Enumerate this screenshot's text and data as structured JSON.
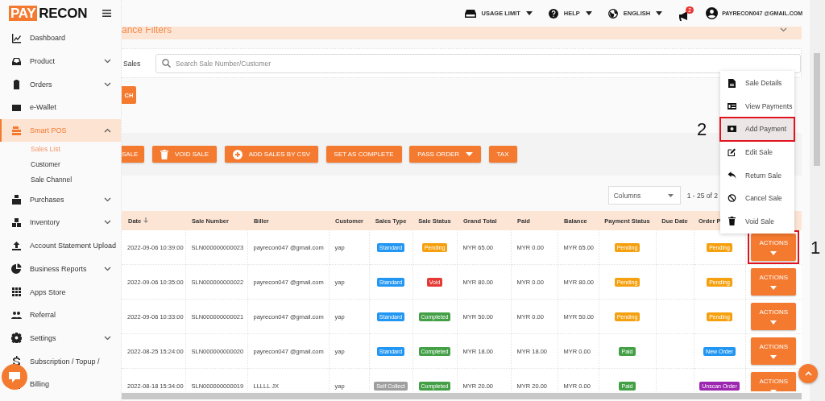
{
  "logo": {
    "left": "PAY",
    "right": "RECON"
  },
  "topbar": {
    "items": [
      {
        "label": "USAGE LIMIT",
        "kind": "storage"
      },
      {
        "label": "HELP",
        "kind": "help"
      },
      {
        "label": "ENGLISH",
        "kind": "globe"
      }
    ],
    "notifications": "2",
    "user": "PAYRECON047 @GMAIL.COM"
  },
  "sidebar": {
    "items": [
      {
        "label": "Dashboard",
        "selected": false
      },
      {
        "label": "Product",
        "selected": false,
        "expanded": false
      },
      {
        "label": "Orders",
        "selected": false,
        "expanded": false
      },
      {
        "label": "e-Wallet",
        "selected": false
      },
      {
        "label": "Smart POS",
        "selected": true,
        "expanded": true,
        "children": [
          {
            "label": "Sales List",
            "selected": true
          },
          {
            "label": "Customer",
            "selected": false
          },
          {
            "label": "Sale Channel",
            "selected": false
          }
        ]
      },
      {
        "label": "Purchases",
        "selected": false,
        "expanded": false
      },
      {
        "label": "Inventory",
        "selected": false,
        "expanded": false
      },
      {
        "label": "Account Statement Upload",
        "selected": false
      },
      {
        "label": "Business Reports",
        "selected": false,
        "expanded": false
      },
      {
        "label": "Apps Store",
        "selected": false
      },
      {
        "label": "Referral",
        "selected": false
      },
      {
        "label": "Settings",
        "selected": false,
        "expanded": false
      },
      {
        "label": "Subscription / Topup /",
        "selected": false
      },
      {
        "label": "Billing",
        "selected": false
      }
    ]
  },
  "filters": {
    "title": "ance Filters"
  },
  "search": {
    "label": "Sales",
    "placeholder": "Search Sale Number/Customer",
    "button": "CH"
  },
  "toolbar": [
    {
      "label": "SALE",
      "kind": "plain"
    },
    {
      "label": "VOID SALE",
      "kind": "trash"
    },
    {
      "label": "ADD SALES BY CSV",
      "kind": "add"
    },
    {
      "label": "SET AS COMPLETE",
      "kind": "plain"
    },
    {
      "label": "PASS ORDER",
      "kind": "dropdown"
    },
    {
      "label": "TAX",
      "kind": "plain"
    }
  ],
  "columns_select": {
    "placeholder": "Columns"
  },
  "pagination": "1 - 25 of 2",
  "table": {
    "columns": [
      "Date",
      "Sale Number",
      "Biller",
      "Customer",
      "Sales Type",
      "Sale Status",
      "Grand Total",
      "Paid",
      "Balance",
      "Payment Status",
      "Due Date",
      "Order P"
    ],
    "rows": [
      {
        "date": "2022-09-06 10:39:00",
        "sale_number": "SLN000000000023",
        "biller": "payrecon047 @gmail.com",
        "customer": "yap",
        "sales_type": {
          "text": "Standard",
          "color": "#2196f3"
        },
        "sale_status": {
          "text": "Pending",
          "color": "#f5a00f"
        },
        "grand_total": "MYR 65.00",
        "paid": "MYR 0.00",
        "balance": "MYR 65.00",
        "payment_status": {
          "text": "Pending",
          "color": "#f5a00f"
        },
        "order_status": {
          "text": "Pending",
          "color": "#f5a00f"
        },
        "action": "ACTIONS",
        "highlighted": true
      },
      {
        "date": "2022-09-06 10:35:00",
        "sale_number": "SLN000000000022",
        "biller": "payrecon047 @gmail.com",
        "customer": "yap",
        "sales_type": {
          "text": "Standard",
          "color": "#2196f3"
        },
        "sale_status": {
          "text": "Void",
          "color": "#e53935"
        },
        "grand_total": "MYR 80.00",
        "paid": "MYR 0.00",
        "balance": "MYR 80.00",
        "payment_status": {
          "text": "Pending",
          "color": "#f5a00f"
        },
        "order_status": {
          "text": "Pending",
          "color": "#f5a00f"
        },
        "action": "ACTIONS",
        "highlighted": false
      },
      {
        "date": "2022-09-06 10:33:00",
        "sale_number": "SLN000000000021",
        "biller": "payrecon047 @gmail.com",
        "customer": "yap",
        "sales_type": {
          "text": "Standard",
          "color": "#2196f3"
        },
        "sale_status": {
          "text": "Completed",
          "color": "#43a047"
        },
        "grand_total": "MYR 50.00",
        "paid": "MYR 0.00",
        "balance": "MYR 50.00",
        "payment_status": {
          "text": "Pending",
          "color": "#f5a00f"
        },
        "order_status": {
          "text": "Pending",
          "color": "#f5a00f"
        },
        "action": "ACTIONS",
        "highlighted": false
      },
      {
        "date": "2022-08-25 15:24:00",
        "sale_number": "SLN000000000020",
        "biller": "payrecon047 @gmail.com",
        "customer": "yap",
        "sales_type": {
          "text": "Standard",
          "color": "#2196f3"
        },
        "sale_status": {
          "text": "Completed",
          "color": "#43a047"
        },
        "grand_total": "MYR 18.00",
        "paid": "MYR 18.00",
        "balance": "MYR 0.00",
        "payment_status": {
          "text": "Paid",
          "color": "#43a047"
        },
        "order_status": {
          "text": "New Order",
          "color": "#2196f3"
        },
        "action": "ACTIONS",
        "highlighted": false
      },
      {
        "date": "2022-08-18 15:34:00",
        "sale_number": "SLN000000000019",
        "biller": "LLLLL JX",
        "customer": "yap",
        "sales_type": {
          "text": "Self Collect",
          "color": "#9e9e9e"
        },
        "sale_status": {
          "text": "Completed",
          "color": "#43a047"
        },
        "grand_total": "MYR 20.00",
        "paid": "MYR 20.00",
        "balance": "MYR 0.00",
        "payment_status": {
          "text": "Paid",
          "color": "#43a047"
        },
        "order_status": {
          "text": "Unscan Order",
          "color": "#9c27b0"
        },
        "action": "ACTIONS",
        "highlighted": false
      }
    ]
  },
  "actions_menu": [
    {
      "label": "Sale Details",
      "kind": "file",
      "selected": false
    },
    {
      "label": "View Payments",
      "kind": "card",
      "selected": false
    },
    {
      "label": "Add Payment",
      "kind": "money",
      "selected": true
    },
    {
      "label": "Edit Sale",
      "kind": "edit",
      "selected": false
    },
    {
      "label": "Return Sale",
      "kind": "reply",
      "selected": false
    },
    {
      "label": "Cancel Sale",
      "kind": "ban",
      "selected": false
    },
    {
      "label": "Void Sale",
      "kind": "trash",
      "selected": false
    }
  ],
  "annotations": [
    "2",
    "1"
  ]
}
